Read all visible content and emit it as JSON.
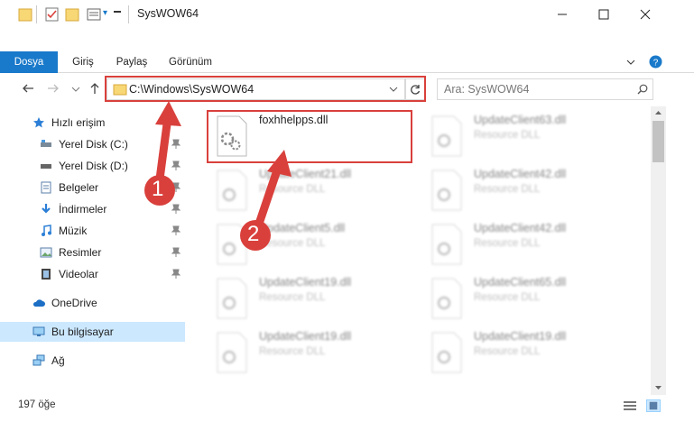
{
  "window": {
    "title": "SysWOW64",
    "qa_dropdown": "▾"
  },
  "ribbon": {
    "tabs": [
      "Dosya",
      "Giriş",
      "Paylaş",
      "Görünüm"
    ]
  },
  "address": {
    "path": "C:\\Windows\\SysWOW64",
    "search_placeholder": "Ara: SysWOW64"
  },
  "sidebar": {
    "items": [
      {
        "label": "Hızlı erişim",
        "icon": "star-icon"
      },
      {
        "label": "Yerel Disk (C:)",
        "icon": "drive-icon"
      },
      {
        "label": "Yerel Disk (D:)",
        "icon": "drive-icon"
      },
      {
        "label": "Belgeler",
        "icon": "documents-icon"
      },
      {
        "label": "İndirmeler",
        "icon": "download-icon"
      },
      {
        "label": "Müzik",
        "icon": "music-icon"
      },
      {
        "label": "Resimler",
        "icon": "pictures-icon"
      },
      {
        "label": "Videolar",
        "icon": "videos-icon"
      },
      {
        "label": "OneDrive",
        "icon": "cloud-icon"
      },
      {
        "label": "Bu bilgisayar",
        "icon": "computer-icon"
      },
      {
        "label": "Ağ",
        "icon": "network-icon"
      }
    ]
  },
  "files": {
    "left": [
      {
        "name": "foxhhelpps.dll",
        "type": ""
      },
      {
        "name": "UpdateClient21.dll",
        "type": "Resource DLL"
      },
      {
        "name": "UpdateClient5.dll",
        "type": "Resource DLL"
      },
      {
        "name": "UpdateClient19.dll",
        "type": "Resource DLL"
      },
      {
        "name": "UpdateClient19.dll",
        "type": "Resource DLL"
      }
    ],
    "right": [
      {
        "name": "UpdateClient63.dll",
        "type": "Resource DLL"
      },
      {
        "name": "UpdateClient42.dll",
        "type": "Resource DLL"
      },
      {
        "name": "UpdateClient42.dll",
        "type": "Resource DLL"
      },
      {
        "name": "UpdateClient65.dll",
        "type": "Resource DLL"
      },
      {
        "name": "UpdateClient19.dll",
        "type": "Resource DLL"
      }
    ]
  },
  "annotations": {
    "step1": "1",
    "step2": "2"
  },
  "status": {
    "count": "197 öğe"
  },
  "colors": {
    "accent": "#1979ca",
    "highlight": "#d9403c",
    "selected_bg": "#cce8ff"
  }
}
